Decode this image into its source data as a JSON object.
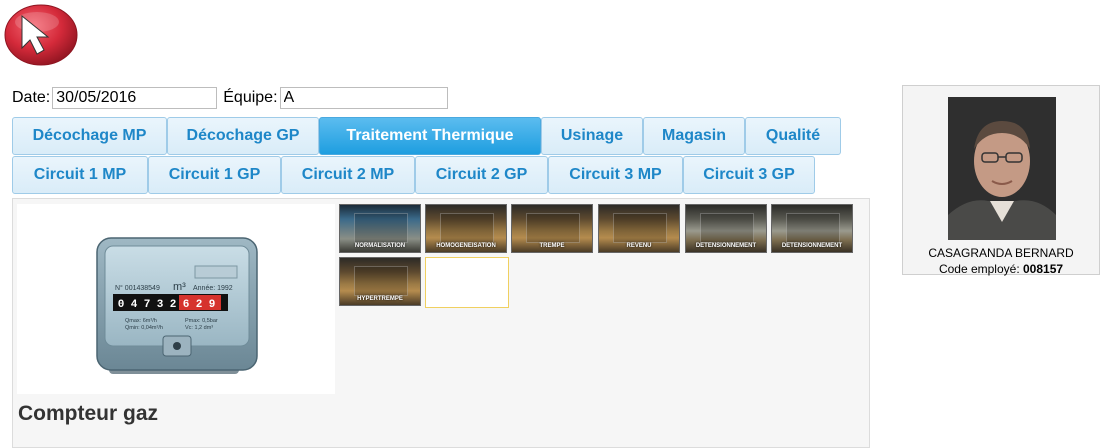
{
  "header": {
    "back_icon": "back-arrow-icon"
  },
  "form": {
    "date_label": "Date:",
    "date_value": "30/05/2016",
    "team_label": "Équipe:",
    "team_value": "A"
  },
  "tabs_row1": [
    {
      "label": "Décochage MP",
      "active": false
    },
    {
      "label": "Décochage GP",
      "active": false
    },
    {
      "label": "Traitement Thermique",
      "active": true
    },
    {
      "label": "Usinage",
      "active": false
    },
    {
      "label": "Magasin",
      "active": false
    },
    {
      "label": "Qualité",
      "active": false
    }
  ],
  "tabs_row2": [
    {
      "label": "Circuit 1 MP"
    },
    {
      "label": "Circuit 1 GP"
    },
    {
      "label": "Circuit 2 MP"
    },
    {
      "label": "Circuit 2 GP"
    },
    {
      "label": "Circuit 3 MP"
    },
    {
      "label": "Circuit 3 GP"
    }
  ],
  "meter": {
    "title": "Compteur gaz",
    "serial": "N° 001438549",
    "unit": "m³",
    "year_label": "Année: 1992",
    "digits_black": [
      "0",
      "4",
      "7",
      "3",
      "2"
    ],
    "digits_red": [
      "6",
      "2",
      "9"
    ],
    "qmax": "Qmax: 6m³/h",
    "qmin": "Qmin: 0,04m³/h",
    "pmax": "Pmax: 0,5bar",
    "vc": "Vc: 1,2 dm³"
  },
  "thumbnails": [
    {
      "caption": "NORMALISATION",
      "tone": "cool"
    },
    {
      "caption": "HOMOGENEISATION",
      "tone": "warm"
    },
    {
      "caption": "TREMPE",
      "tone": "warm"
    },
    {
      "caption": "REVENU",
      "tone": "warm"
    },
    {
      "caption": "DETENSIONNEMENT",
      "tone": "gray"
    },
    {
      "caption": "DETENSIONNEMENT",
      "tone": "gray"
    },
    {
      "caption": "HYPERTREMPE",
      "tone": "warm"
    }
  ],
  "employee": {
    "name": "CASAGRANDA BERNARD",
    "code_label": "Code employé:",
    "code_value": "008157"
  },
  "colors": {
    "tab_active": "#1e9ee0",
    "tab_text": "#1e87c8",
    "back_button": "#d42a3a"
  }
}
